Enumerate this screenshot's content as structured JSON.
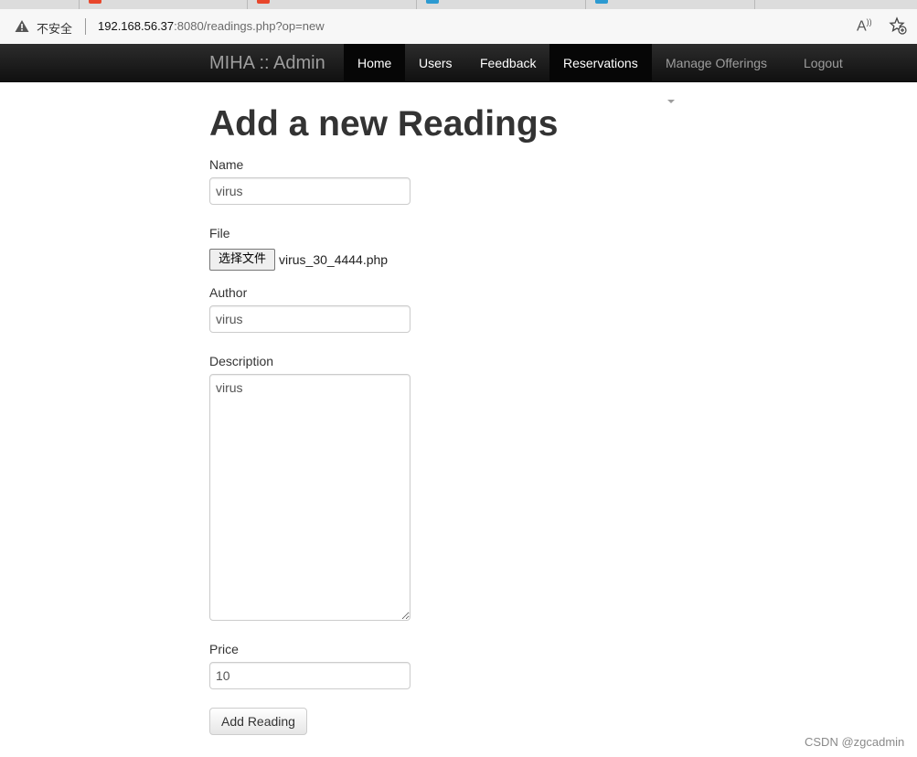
{
  "browser": {
    "insecure_label": "不安全",
    "url_host": "192.168.56.37",
    "url_rest": ":8080/readings.php?op=new",
    "icons": [
      "warning-icon",
      "read-aloud-icon",
      "add-favorite-icon"
    ],
    "colors": {
      "tab_accent_red": "#e8462b",
      "tab_accent_blue": "#2c9ad1"
    }
  },
  "navbar": {
    "brand": "MIHA :: Admin",
    "items": [
      {
        "label": "Home"
      },
      {
        "label": "Users"
      },
      {
        "label": "Feedback"
      },
      {
        "label": "Reservations"
      },
      {
        "label": "Manage Offerings"
      },
      {
        "label": "Logout"
      }
    ]
  },
  "form": {
    "title": "Add a new Readings",
    "name_label": "Name",
    "name_value": "virus",
    "file_label": "File",
    "file_button": "选择文件",
    "file_name": "virus_30_4444.php",
    "author_label": "Author",
    "author_value": "virus",
    "description_label": "Description",
    "description_value": "virus",
    "price_label": "Price",
    "price_value": "10",
    "submit_label": "Add Reading"
  },
  "watermark": "CSDN @zgcadmin"
}
